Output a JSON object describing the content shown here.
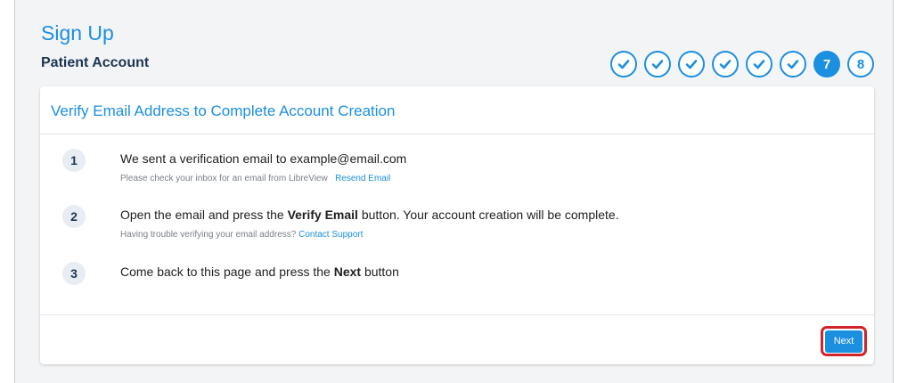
{
  "page": {
    "title": "Sign Up",
    "subtitle": "Patient Account"
  },
  "progress": {
    "completed_icon": "check-icon",
    "steps": [
      {
        "state": "done"
      },
      {
        "state": "done"
      },
      {
        "state": "done"
      },
      {
        "state": "done"
      },
      {
        "state": "done"
      },
      {
        "state": "done"
      },
      {
        "state": "current",
        "label": "7"
      },
      {
        "state": "upcoming",
        "label": "8"
      }
    ],
    "accent_color": "#1b8fe0"
  },
  "card": {
    "heading": "Verify Email Address to Complete Account Creation",
    "items": [
      {
        "number": "1",
        "text": "We sent a verification email to example@email.com",
        "sub_text": "Please check your inbox for an email from LibreView",
        "link": "Resend Email"
      },
      {
        "number": "2",
        "text_before": "Open the email and press the ",
        "text_bold": "Verify Email",
        "text_after": " button. Your account creation will be complete.",
        "sub_text": "Having trouble verifying your email address?",
        "link": "Contact Support"
      },
      {
        "number": "3",
        "text_before": "Come back to this page and press the ",
        "text_bold": "Next",
        "text_after": " button"
      }
    ],
    "next_label": "Next",
    "highlight_color": "#d2232a"
  }
}
